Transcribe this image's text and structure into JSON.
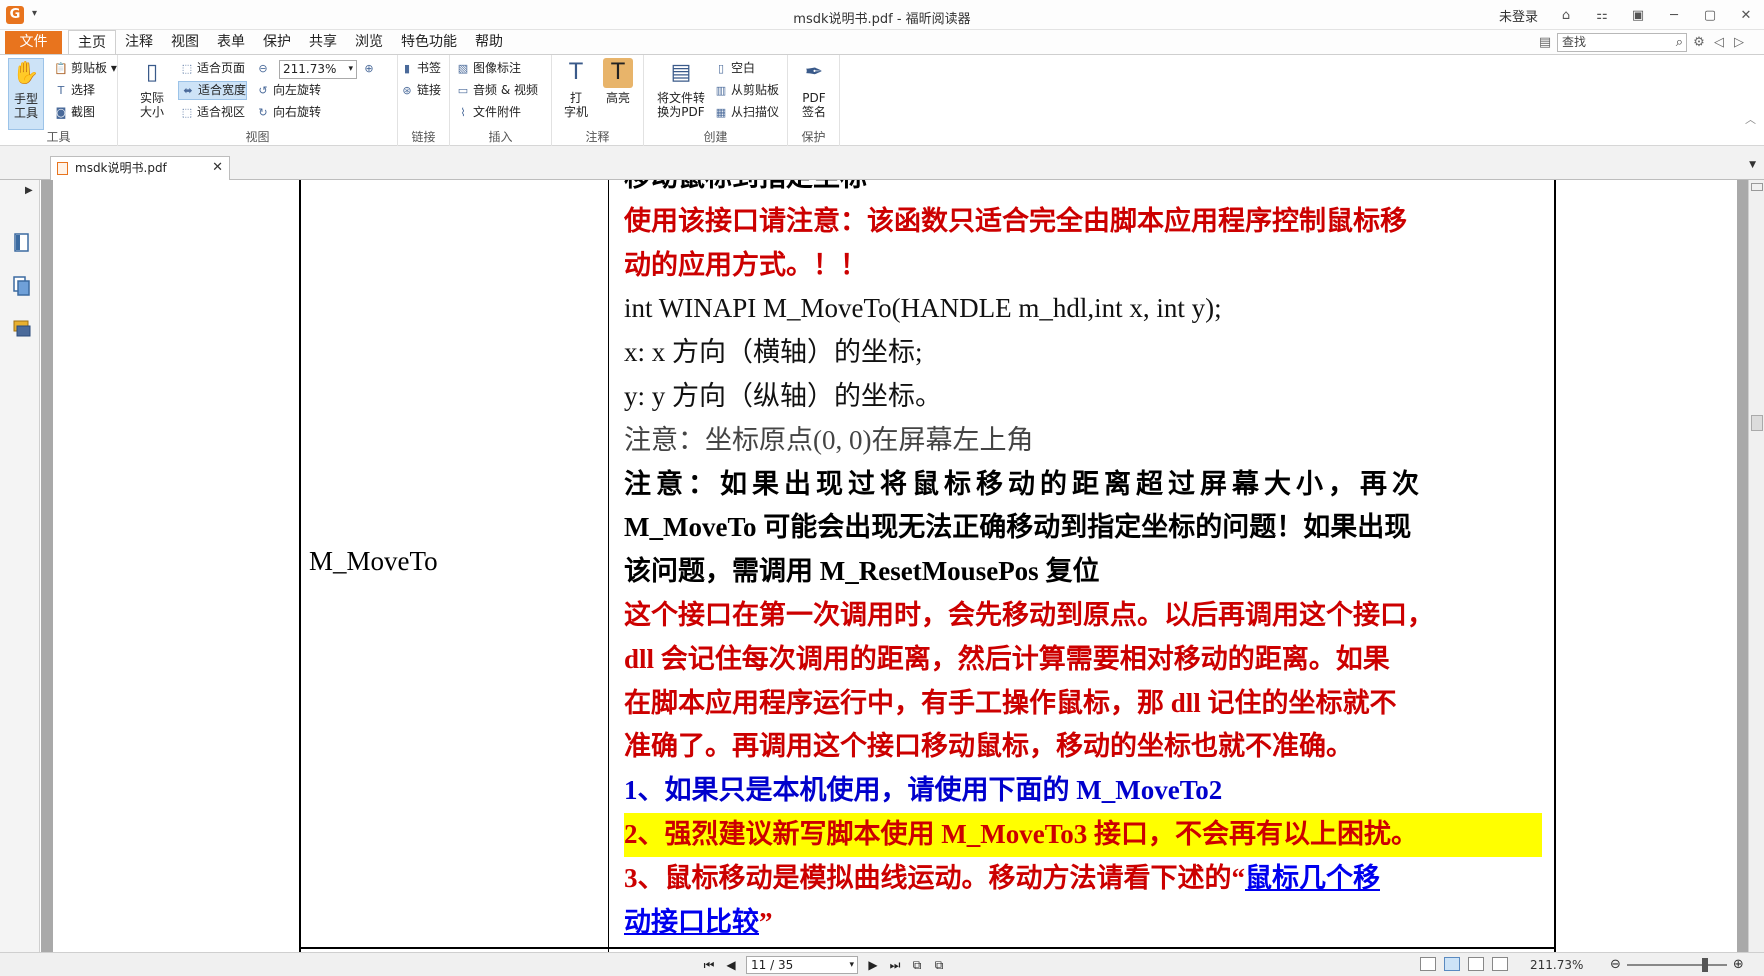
{
  "titlebar": {
    "title": "msdk说明书.pdf - 福昕阅读器",
    "login": "未登录"
  },
  "menu": {
    "file": "文件",
    "tabs": [
      "主页",
      "注释",
      "视图",
      "表单",
      "保护",
      "共享",
      "浏览",
      "特色功能",
      "帮助"
    ],
    "active_tab": "主页",
    "search_placeholder": "查找"
  },
  "ribbon": {
    "tools": {
      "hand": "手型\n工具",
      "clipboard": "剪贴板",
      "select": "选择",
      "snapshot": "截图",
      "label": "工具"
    },
    "view": {
      "actual_size": "实际\n大小",
      "fit_page": "适合页面",
      "fit_width": "适合宽度",
      "fit_visible": "适合视区",
      "zoom": "211.73%",
      "rotate_left": "向左旋转",
      "rotate_right": "向右旋转",
      "label": "视图"
    },
    "links": {
      "bookmark": "书签",
      "link": "链接",
      "label": "链接"
    },
    "insert": {
      "image_annot": "图像标注",
      "audio_video": "音频 & 视频",
      "file_attach": "文件附件",
      "label": "插入"
    },
    "comment": {
      "typewriter": "打\n字机",
      "highlight": "高亮",
      "label": "注释"
    },
    "create": {
      "convert": "将文件转\n换为PDF",
      "blank": "空白",
      "from_clipboard": "从剪贴板",
      "from_scanner": "从扫描仪",
      "label": "创建"
    },
    "protect": {
      "sign": "PDF\n签名",
      "label": "保护"
    }
  },
  "doctab": {
    "name": "msdk说明书.pdf"
  },
  "document": {
    "function_name": "M_MoveTo",
    "partial_top": "移动鼠标到指定坐标",
    "lines": {
      "l1": "使用该接口请注意：该函数只适合完全由脚本应用程序控制鼠标移",
      "l2": "动的应用方式。！！",
      "l3": "int WINAPI M_MoveTo(HANDLE m_hdl,int x, int y);",
      "l4": "x: x 方向（横轴）的坐标;",
      "l5": "y: y 方向（纵轴）的坐标。",
      "l6": "注意：坐标原点(0, 0)在屏幕左上角",
      "l7": "注意：如果出现过将鼠标移动的距离超过屏幕大小，再次",
      "l8": "M_MoveTo 可能会出现无法正确移动到指定坐标的问题！如果出现",
      "l9": "该问题，需调用 M_ResetMousePos 复位",
      "l10": "这个接口在第一次调用时，会先移动到原点。以后再调用这个接口，",
      "l11": "dll 会记住每次调用的距离，然后计算需要相对移动的距离。如果",
      "l12": "在脚本应用程序运行中，有手工操作鼠标，那 dll 记住的坐标就不",
      "l13": "准确了。再调用这个接口移动鼠标，移动的坐标也就不准确。",
      "l14": "1、如果只是本机使用，请使用下面的 M_MoveTo2",
      "l15": "2、强烈建议新写脚本使用 M_MoveTo3 接口，不会再有以上困扰。",
      "l16a": "3、鼠标移动是模拟曲线运动。移动方法请看下述的“",
      "l16b": "鼠标几个移",
      "l17a": "动接口比较",
      "l17b": "”"
    }
  },
  "statusbar": {
    "page": "11 / 35",
    "zoom": "211.73%"
  }
}
